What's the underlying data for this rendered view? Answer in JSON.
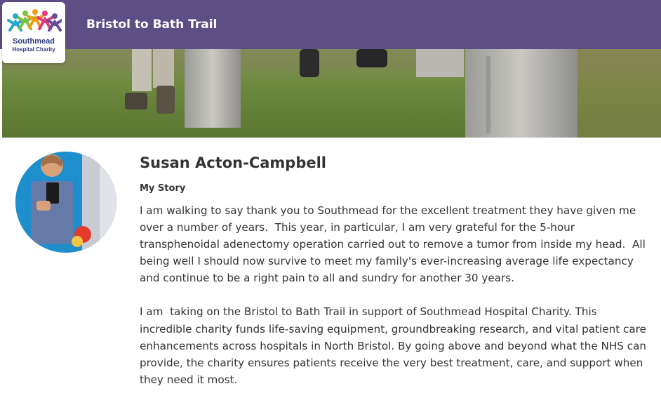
{
  "header": {
    "title": "Bristol to Bath Trail",
    "logo": {
      "name": "Southmead",
      "subtitle": "Hospital Charity"
    }
  },
  "profile": {
    "name": "Susan Acton-Campbell",
    "story_heading": "My Story",
    "story_paragraphs": [
      "I am walking to say thank you to Southmead for the excellent treatment they have given me over a number of years.  This year, in particular, I am very grateful for the 5-hour transphenoidal adenectomy operation carried out to remove a tumor from inside my head.  All being well I should now survive to meet my family's ever-increasing average life expectancy and continue to be a right pain to all and sundry for another 30 years.",
      "I am  taking on the Bristol to Bath Trail in support of Southmead Hospital Charity. This incredible charity funds life-saving equipment, groundbreaking research, and vital patient care enhancements across hospitals in North Bristol. By going above and beyond what the NHS can provide, the charity ensures patients receive the very best treatment, care, and support when they need it most."
    ]
  },
  "colors": {
    "header_bg": "#5e4e86",
    "logo_text": "#2e3a7c",
    "body_text": "#333333"
  }
}
